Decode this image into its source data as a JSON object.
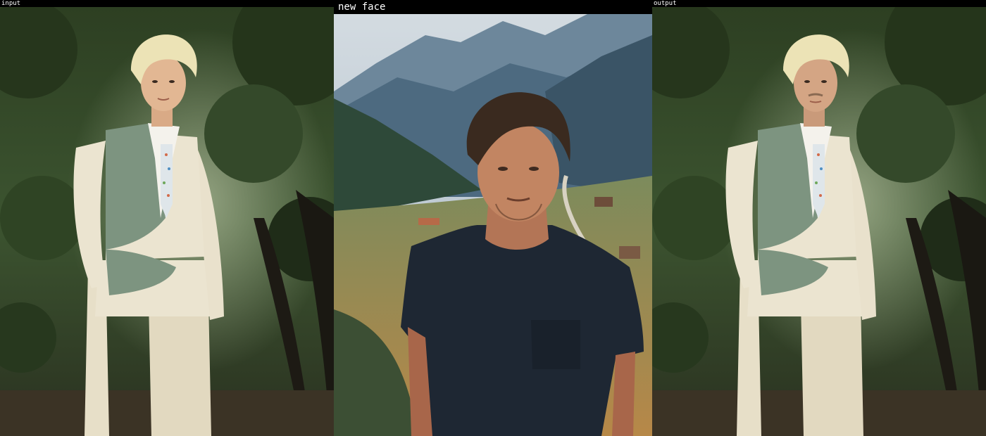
{
  "panels": {
    "input": {
      "label": "input"
    },
    "new_face": {
      "label": "new face"
    },
    "output": {
      "label": "output"
    }
  },
  "colors": {
    "background": "#000000",
    "label_text": "#ffffff",
    "foliage_dark": "#1f2c18",
    "foliage_mid": "#3d5530",
    "vest_sage": "#7d9480",
    "suit_cream": "#ebe4d0",
    "hair_platinum": "#ece3b6",
    "tshirt_navy": "#1e2733",
    "mountain_blue": "#4d6a80",
    "sky": "#c9d3dc"
  }
}
